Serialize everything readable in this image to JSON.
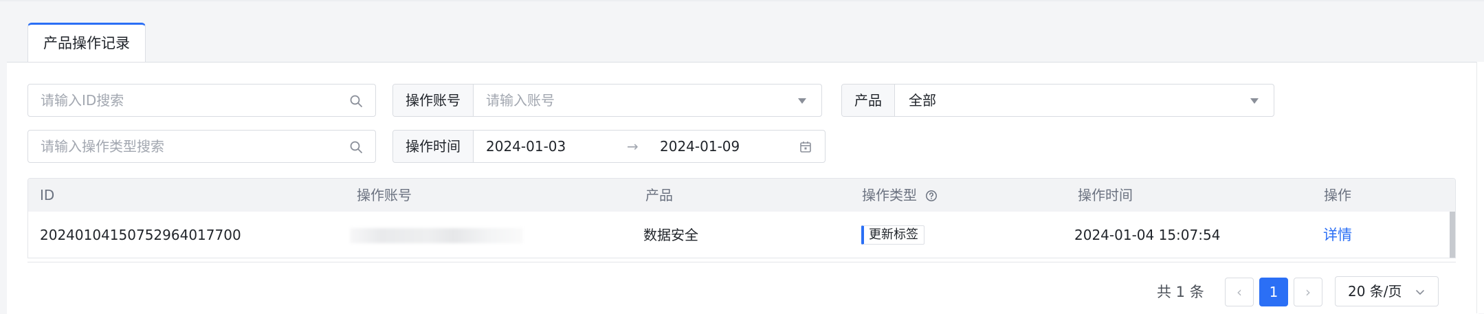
{
  "tab": {
    "label": "产品操作记录"
  },
  "filters": {
    "id_search": {
      "placeholder": "请输入ID搜索"
    },
    "type_search": {
      "placeholder": "请输入操作类型搜索"
    },
    "account": {
      "label": "操作账号",
      "placeholder": "请输入账号"
    },
    "product": {
      "label": "产品",
      "value": "全部"
    },
    "time": {
      "label": "操作时间",
      "start": "2024-01-03",
      "separator": "→",
      "end": "2024-01-09"
    }
  },
  "table": {
    "columns": {
      "id": "ID",
      "account": "操作账号",
      "product": "产品",
      "op_type": "操作类型",
      "op_time": "操作时间",
      "action": "操作"
    },
    "rows": [
      {
        "id": "20240104150752964017700",
        "account": "",
        "product": "数据安全",
        "op_type": "更新标签",
        "op_time": "2024-01-04 15:07:54",
        "action": "详情"
      }
    ]
  },
  "pagination": {
    "total_text": "共 1 条",
    "prev": "‹",
    "current_page": "1",
    "next": "›",
    "page_size": "20 条/页"
  },
  "colors": {
    "accent": "#2b6ff5",
    "header_bg": "#f2f3f5"
  },
  "icons": [
    "search-icon",
    "caret-down-icon",
    "calendar-icon",
    "help-circle-icon",
    "chevron-left-icon",
    "chevron-right-icon",
    "chevron-down-icon"
  ]
}
